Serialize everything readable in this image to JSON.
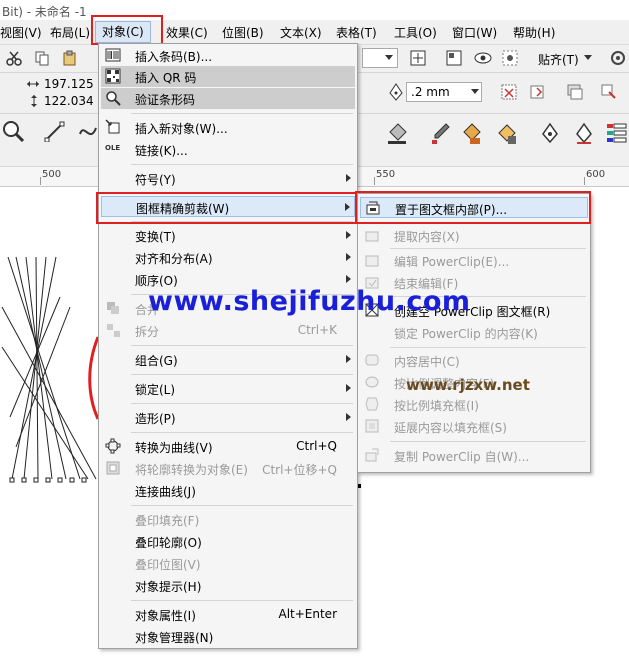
{
  "window": {
    "title": "Bit) - 未命名 -1"
  },
  "menubar": {
    "items": [
      "视图(V)",
      "布局(L)",
      "对象(C)",
      "效果(C)",
      "位图(B)",
      "文本(X)",
      "表格(T)",
      "工具(O)",
      "窗口(W)",
      "帮助(H)"
    ]
  },
  "toolbar": {
    "snap_label": "贴齐(T)",
    "width_value": "197.125 m",
    "height_value": "122.034 m",
    "outline_value": ".2 mm"
  },
  "ruler": {
    "labels": [
      "500",
      "550",
      "600"
    ]
  },
  "object_menu": {
    "items": [
      {
        "label": "插入条码(B)...",
        "icon": "barcode-icon"
      },
      {
        "label": "插入 QR 码",
        "icon": "qr-code-icon"
      },
      {
        "label": "验证条形码",
        "icon": "magnifier-icon"
      },
      {
        "label": "插入新对象(W)...",
        "icon": "insert-object-icon"
      },
      {
        "label": "链接(K)...",
        "icon": "ole-icon",
        "icon_text": "OLE"
      },
      {
        "label": "符号(Y)"
      },
      {
        "label": "图框精确剪裁(W)"
      },
      {
        "label": "变换(T)"
      },
      {
        "label": "对齐和分布(A)"
      },
      {
        "label": "顺序(O)"
      },
      {
        "label": "合并",
        "shortcut": ""
      },
      {
        "label": "拆分",
        "shortcut": "Ctrl+K"
      },
      {
        "label": "组合(G)"
      },
      {
        "label": "锁定(L)"
      },
      {
        "label": "造形(P)"
      },
      {
        "label": "转换为曲线(V)",
        "shortcut": "Ctrl+Q"
      },
      {
        "label": "将轮廓转换为对象(E)",
        "shortcut": "Ctrl+位移+Q"
      },
      {
        "label": "连接曲线(J)"
      },
      {
        "label": "叠印填充(F)"
      },
      {
        "label": "叠印轮廓(O)"
      },
      {
        "label": "叠印位图(V)"
      },
      {
        "label": "对象提示(H)"
      },
      {
        "label": "对象属性(I)",
        "shortcut": "Alt+Enter"
      },
      {
        "label": "对象管理器(N)"
      }
    ]
  },
  "powerclip_menu": {
    "items": [
      {
        "label": "置于图文框内部(P)..."
      },
      {
        "label": "提取内容(X)"
      },
      {
        "label": "编辑 PowerClip(E)..."
      },
      {
        "label": "结束编辑(F)"
      },
      {
        "label": "创建空 PowerClip 图文框(R)"
      },
      {
        "label": "锁定 PowerClip 的内容(K)"
      },
      {
        "label": "内容居中(C)"
      },
      {
        "label": "按比例调整内容(F)"
      },
      {
        "label": "按比例填充框(I)"
      },
      {
        "label": "延展内容以填充框(S)"
      },
      {
        "label": "复制 PowerClip 自(W)..."
      }
    ]
  },
  "watermarks": {
    "main": "www.shejifuzhu.com",
    "secondary": "www.rjzxw.net"
  },
  "colors": {
    "highlight_red": "#e02020",
    "watermark_blue": "#1a20d8"
  }
}
